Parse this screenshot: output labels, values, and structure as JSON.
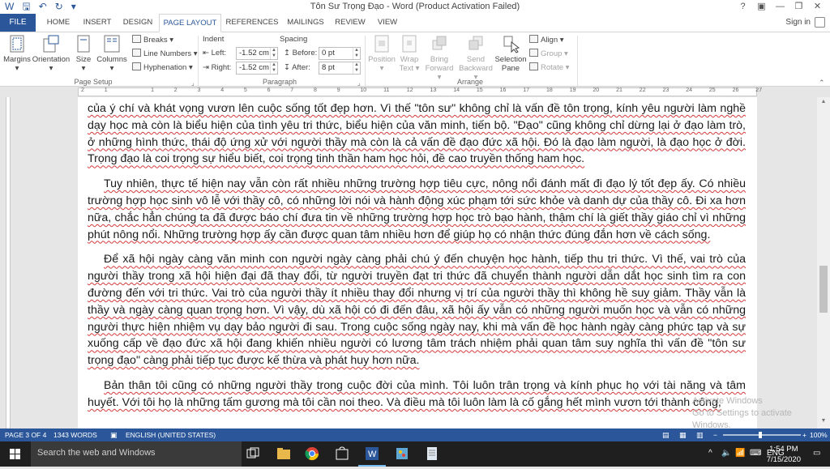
{
  "window": {
    "title": "Tôn Sư Trọng Đạo - Word (Product Activation Failed)",
    "controls": [
      "?",
      "▣",
      "—",
      "❐",
      "✕"
    ]
  },
  "tabs": {
    "file": "FILE",
    "items": [
      "HOME",
      "INSERT",
      "DESIGN",
      "PAGE LAYOUT",
      "REFERENCES",
      "MAILINGS",
      "REVIEW",
      "VIEW"
    ],
    "active": "PAGE LAYOUT",
    "signin": "Sign in"
  },
  "ribbon": {
    "page_setup": {
      "label": "Page Setup",
      "margins": "Margins",
      "orientation": "Orientation",
      "size": "Size",
      "columns": "Columns",
      "breaks": "Breaks",
      "line_numbers": "Line Numbers",
      "hyphenation": "Hyphenation"
    },
    "paragraph": {
      "label": "Paragraph",
      "indent_header": "Indent",
      "spacing_header": "Spacing",
      "left_label": "Left:",
      "left_value": "-1.52 cm",
      "right_label": "Right:",
      "right_value": "-1.52 cm",
      "before_label": "Before:",
      "before_value": "0 pt",
      "after_label": "After:",
      "after_value": "8 pt"
    },
    "arrange": {
      "label": "Arrange",
      "position": "Position",
      "wrap_text": [
        "Wrap",
        "Text"
      ],
      "bring_forward": [
        "Bring",
        "Forward"
      ],
      "send_backward": [
        "Send",
        "Backward"
      ],
      "selection_pane": [
        "Selection",
        "Pane"
      ],
      "align": "Align",
      "group": "Group",
      "rotate": "Rotate"
    }
  },
  "ruler": {
    "numbers": [
      "2",
      "1",
      "",
      "1",
      "2",
      "3",
      "4",
      "5",
      "6",
      "7",
      "8",
      "9",
      "10",
      "11",
      "12",
      "13",
      "14",
      "15",
      "16",
      "17",
      "18",
      "19",
      "20",
      "21",
      "22",
      "23",
      "24",
      "25",
      "26",
      "27"
    ]
  },
  "document": {
    "paragraphs": [
      "của ý chí và khát vọng vươn lên cuộc sống tốt đẹp hơn. Vì thế \"tôn sư\" không chỉ là vấn đề tôn trọng, kính yêu người làm nghề dạy học mà còn là biểu hiện của tình yêu tri thức, biểu hiện của văn minh, tiến bộ. \"Đạo\" cũng không chỉ dừng lại ở đạo làm trò, ở những hình thức, thái độ ứng xử với người thầy mà còn là cả vấn đề đạo đức xã hội. Đó là đạo làm người, là đạo học ở đời. Trọng đạo là coi trọng sự hiểu biết, coi trọng tinh thần ham học hỏi, đề cao truyền thống ham học.",
      "Tuy nhiên, thực tế hiện nay vẫn còn rất nhiều những trường hợp tiêu cực, nông nổi đánh mất đi đạo lý tốt đẹp ấy. Có nhiều trường hợp học sinh vô lễ với thầy cô, có những lời nói và hành động xúc phạm tới sức khỏe và danh dự của thầy cô. Đi xa hơn nữa, chắc hẳn chúng ta đã được báo chí đưa tin về những trường hợp học trò bạo hành, thậm chí là giết thầy giáo chỉ vì những phút nông nổi. Những trường hợp ấy cần được quan tâm nhiều hơn để giúp họ có nhận thức đúng đắn hơn về cách sống.",
      "Để xã hội ngày càng văn minh con người ngày càng phải chú ý đến chuyện học hành, tiếp thu tri thức. Vì thế, vai trò của người thầy trong xã hội hiện đại đã thay đổi, từ người truyền đạt tri thức đã chuyển thành người dẫn dắt học sinh tìm ra con đường đến với tri thức. Vai trò của người thầy ít nhiều thay đổi nhưng vị trí của người thầy thì không hề suy giảm. Thầy vẫn là thầy và ngày càng quan trọng hơn. Vì vậy, dù xã hội có đi đến đâu, xã hội ấy vẫn có những người muốn học và vẫn có những người thực hiện nhiệm vụ dạy bảo người đi sau. Trong cuộc sống ngày nay, khi mà vấn đề học hành ngày càng phức tạp và sự xuống cấp về đạo đức xã hội đang khiến nhiều người có lương tâm trách nhiệm phải quan tâm suy nghĩa thì vấn đề \"tôn sư trọng đạo\" càng phải tiếp tục được kế thừa và phát huy hơn nữa.",
      "Bản thân tôi cũng có những người thầy trong cuộc đời của mình. Tôi luôn trân trọng và kính phục họ với tài năng và tâm huyết. Với tôi họ là những tấm gương mà tôi cần noi theo. Và điều mà tôi luôn làm là cố gắng hết mình vươn tới thành công,"
    ],
    "watermark": [
      "Activate Windows",
      "Go to Settings to activate Windows."
    ]
  },
  "statusbar": {
    "page": "PAGE 3 OF 4",
    "words": "1343 WORDS",
    "language": "ENGLISH (UNITED STATES)",
    "zoom": "100%"
  },
  "taskbar": {
    "search_placeholder": "Search the web and Windows",
    "language": "ENG",
    "time": "1:54 PM",
    "date": "7/15/2020"
  },
  "colors": {
    "accent": "#2b579a",
    "spellcheck": "#d23a3a",
    "taskbar": "#1f1f1f"
  }
}
